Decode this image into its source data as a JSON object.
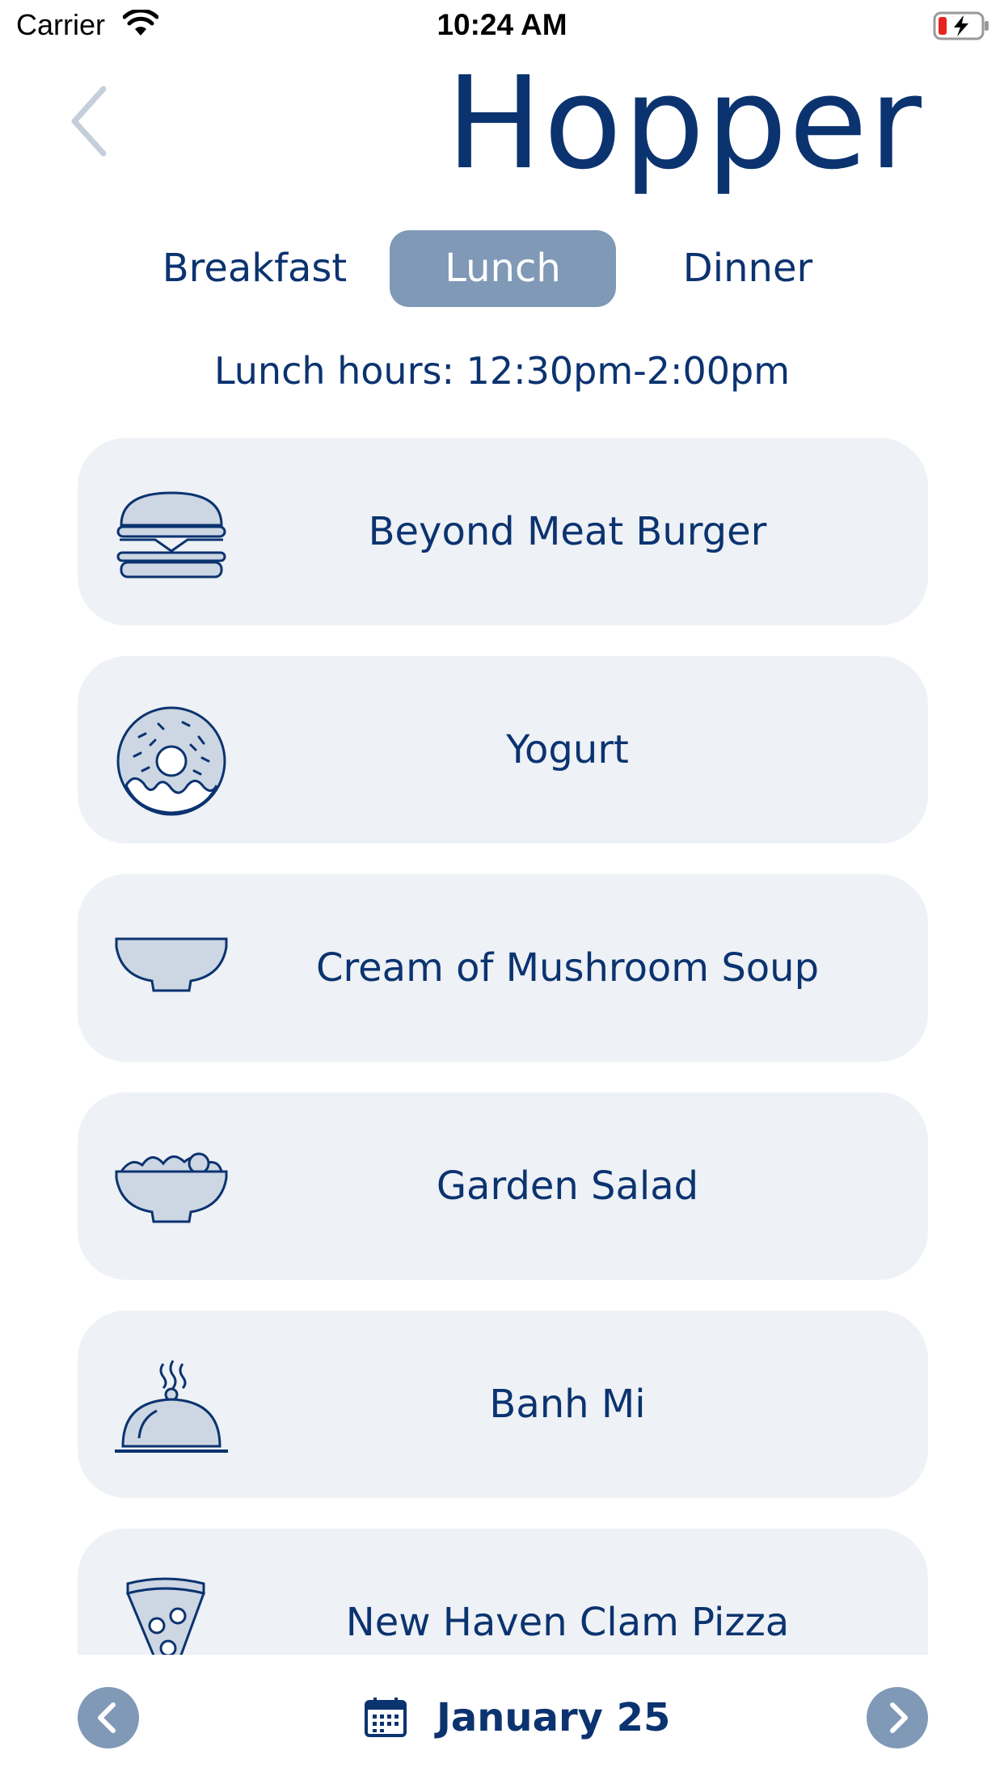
{
  "status_bar": {
    "carrier": "Carrier",
    "time": "10:24 AM"
  },
  "header": {
    "title": "Hopper",
    "back_icon": "chevron-left-icon"
  },
  "tabs": [
    {
      "label": "Breakfast",
      "selected": false
    },
    {
      "label": "Lunch",
      "selected": true
    },
    {
      "label": "Dinner",
      "selected": false
    }
  ],
  "hours_text": "Lunch hours: 12:30pm-2:00pm",
  "menu_items": [
    {
      "label": "Beyond Meat Burger",
      "icon": "burger-icon"
    },
    {
      "label": "Yogurt",
      "icon": "donut-icon"
    },
    {
      "label": "Cream of Mushroom Soup",
      "icon": "bowl-icon"
    },
    {
      "label": "Garden Salad",
      "icon": "salad-icon"
    },
    {
      "label": "Banh Mi",
      "icon": "cloche-icon"
    },
    {
      "label": "New Haven Clam Pizza",
      "icon": "pizza-icon"
    }
  ],
  "bottom_nav": {
    "date": "January 25",
    "prev_icon": "chevron-left-icon",
    "next_icon": "chevron-right-icon",
    "calendar_icon": "calendar-icon"
  },
  "colors": {
    "primary": "#0b3370",
    "accent": "#7f99b6",
    "card": "#eef1f5",
    "icon_fill": "#cdd6e3"
  }
}
